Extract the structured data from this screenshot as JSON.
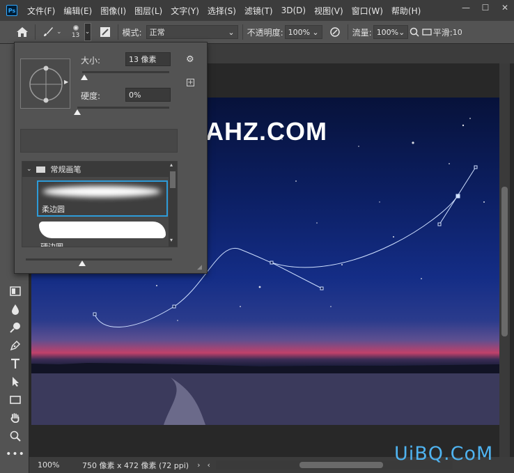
{
  "app": {
    "logo_text": "Ps"
  },
  "menu": [
    "文件(F)",
    "编辑(E)",
    "图像(I)",
    "图层(L)",
    "文字(Y)",
    "选择(S)",
    "滤镜(T)",
    "3D(D)",
    "视图(V)",
    "窗口(W)",
    "帮助(H)"
  ],
  "window_controls": {
    "minimize": "—",
    "maximize": "☐",
    "close": "✕"
  },
  "options": {
    "brush_size": "13",
    "mode_label": "模式:",
    "mode_value": "正常",
    "opacity_label": "不透明度:",
    "opacity_value": "100%",
    "flow_label": "流量:",
    "flow_value": "100%",
    "smoothing_label": "平滑:",
    "smoothing_value": "10"
  },
  "brush_panel": {
    "size_label": "大小:",
    "size_value": "13 像素",
    "hardness_label": "硬度:",
    "hardness_value": "0%",
    "size_fraction": 0.02,
    "hardness_fraction": 0.0,
    "folder_name": "常规画笔",
    "brushes": [
      {
        "name": "柔边圆",
        "selected": true
      },
      {
        "name": "硬边圆",
        "selected": false
      }
    ]
  },
  "canvas": {
    "watermark_text": "AHZ.COM"
  },
  "status": {
    "zoom": "100%",
    "doc_info": "750 像素 x 472 像素 (72 ppi)"
  },
  "site_watermark": "UiBQ.CoM",
  "colors": {
    "accent": "#31a8ff",
    "selection": "#2d9bd8",
    "panel": "#535353"
  }
}
